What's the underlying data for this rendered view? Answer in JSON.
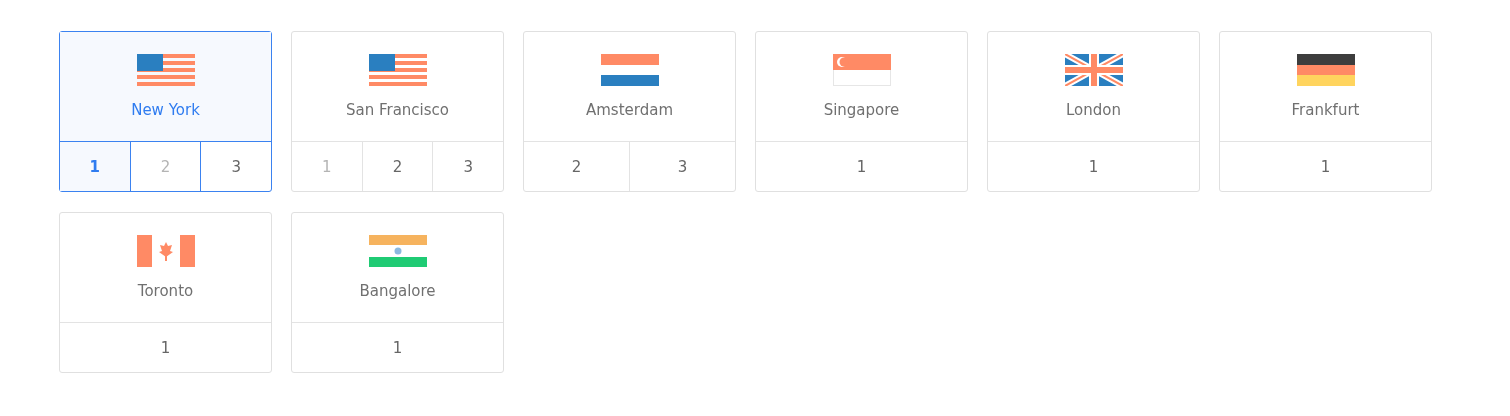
{
  "regions": [
    {
      "name": "New York",
      "kind": "us",
      "selected": true,
      "options": [
        {
          "label": "1",
          "selected": true,
          "disabled": false
        },
        {
          "label": "2",
          "selected": false,
          "disabled": true
        },
        {
          "label": "3",
          "selected": false,
          "disabled": false
        }
      ]
    },
    {
      "name": "San Francisco",
      "kind": "us",
      "selected": false,
      "options": [
        {
          "label": "1",
          "selected": false,
          "disabled": true
        },
        {
          "label": "2",
          "selected": false,
          "disabled": false
        },
        {
          "label": "3",
          "selected": false,
          "disabled": false
        }
      ]
    },
    {
      "name": "Amsterdam",
      "kind": "nl",
      "selected": false,
      "options": [
        {
          "label": "2",
          "selected": false,
          "disabled": false
        },
        {
          "label": "3",
          "selected": false,
          "disabled": false
        }
      ]
    },
    {
      "name": "Singapore",
      "kind": "sg",
      "selected": false,
      "options": [
        {
          "label": "1",
          "selected": false,
          "disabled": false
        }
      ]
    },
    {
      "name": "London",
      "kind": "gb",
      "selected": false,
      "options": [
        {
          "label": "1",
          "selected": false,
          "disabled": false
        }
      ]
    },
    {
      "name": "Frankfurt",
      "kind": "de",
      "selected": false,
      "options": [
        {
          "label": "1",
          "selected": false,
          "disabled": false
        }
      ]
    },
    {
      "name": "Toronto",
      "kind": "ca",
      "selected": false,
      "options": [
        {
          "label": "1",
          "selected": false,
          "disabled": false
        }
      ]
    },
    {
      "name": "Bangalore",
      "kind": "in",
      "selected": false,
      "options": [
        {
          "label": "1",
          "selected": false,
          "disabled": false
        }
      ]
    }
  ]
}
